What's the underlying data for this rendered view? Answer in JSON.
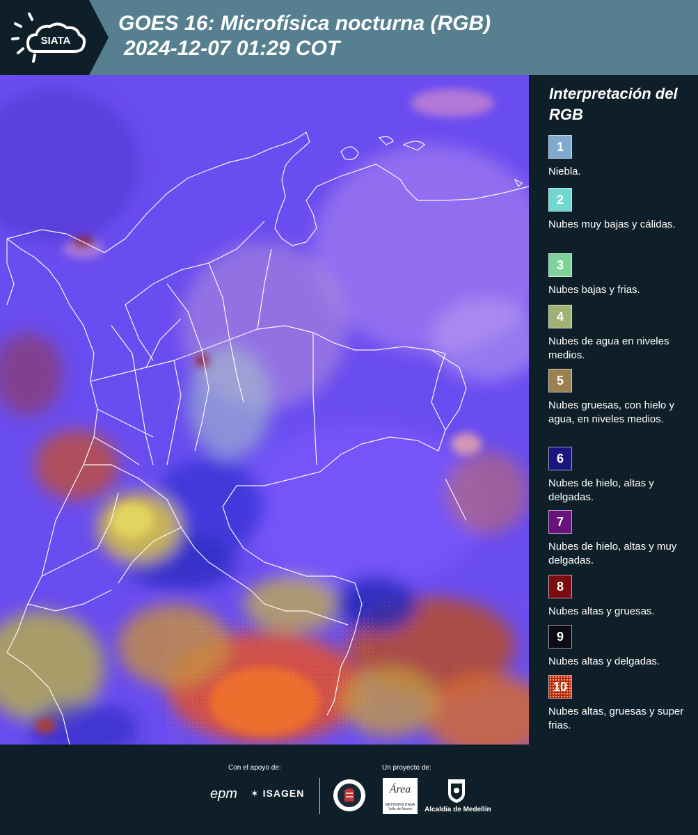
{
  "header": {
    "logo_text": "SIATA",
    "title_line1": "GOES 16: Microfísica nocturna (RGB)",
    "title_line2": "2024-12-07 01:29 COT"
  },
  "legend": {
    "title": "Interpretación del RGB",
    "items": [
      {
        "number": "1",
        "label": "Niebla.",
        "color": "#7fa9cf"
      },
      {
        "number": "2",
        "label": "Nubes muy bajas y cálidas.",
        "color": "#6fd9d1"
      },
      {
        "number": "3",
        "label": "Nubes bajas y frias.",
        "color": "#7fd39a"
      },
      {
        "number": "4",
        "label": "Nubes de agua en niveles medios.",
        "color": "#9fb273"
      },
      {
        "number": "5",
        "label": "Nubes gruesas, con hielo y agua, en niveles medios.",
        "color": "#9b8050"
      },
      {
        "number": "6",
        "label": "Nubes de hielo, altas y delgadas.",
        "color": "#1a157c"
      },
      {
        "number": "7",
        "label": "Nubes de hielo, altas y muy delgadas.",
        "color": "#6a127b"
      },
      {
        "number": "8",
        "label": "Nubes altas y gruesas.",
        "color": "#7b0c0f"
      },
      {
        "number": "9",
        "label": "Nubes altas y delgadas.",
        "color": "#0c0a14"
      },
      {
        "number": "10",
        "label": "Nubes altas, gruesas y super frias.",
        "color": "#b52812"
      }
    ]
  },
  "footer": {
    "support_label": "Con el apoyo de:",
    "project_label": "Un proyecto de:",
    "sponsor1": "epm",
    "sponsor2": "ISAGEN",
    "partner1_line1": "Área",
    "partner1_line2": "METROPOLITANA",
    "partner1_line3": "Valle de Aburrá",
    "partner2": "Alcaldía de Medellín"
  }
}
